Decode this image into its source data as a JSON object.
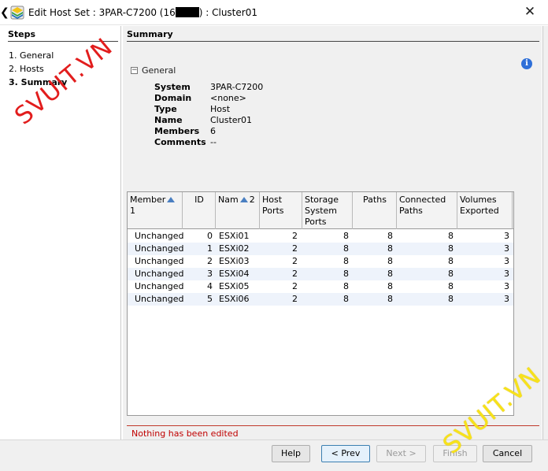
{
  "window": {
    "title_prefix": "Edit Host Set : 3PAR-C7200 (16",
    "title_suffix": ") : Cluster01",
    "close_glyph": "✕"
  },
  "steps": {
    "heading": "Steps",
    "items": [
      {
        "label": "1. General",
        "active": false
      },
      {
        "label": "2. Hosts",
        "active": false
      },
      {
        "label": "3. Summary",
        "active": true
      }
    ]
  },
  "summary": {
    "heading": "Summary",
    "section_label": "General",
    "collapse_glyph": "−",
    "info_glyph": "i",
    "properties": [
      {
        "key": "System",
        "value": "3PAR-C7200"
      },
      {
        "key": "Domain",
        "value": "<none>"
      },
      {
        "key": "Type",
        "value": "Host"
      },
      {
        "key": "Name",
        "value": "Cluster01"
      },
      {
        "key": "Members",
        "value": "6"
      },
      {
        "key": "Comments",
        "value": "--"
      }
    ]
  },
  "table": {
    "columns": [
      {
        "label": "Member",
        "sort_index": "1"
      },
      {
        "label": "ID"
      },
      {
        "label": "Nam",
        "sort_index": "2"
      },
      {
        "label": "Host Ports"
      },
      {
        "label": "Storage System Ports"
      },
      {
        "label": "Paths"
      },
      {
        "label": "Connected Paths"
      },
      {
        "label": "Volumes Exported"
      }
    ],
    "rows": [
      [
        "Unchanged",
        "0",
        "ESXi01",
        "2",
        "8",
        "8",
        "8",
        "3"
      ],
      [
        "Unchanged",
        "1",
        "ESXi02",
        "2",
        "8",
        "8",
        "8",
        "3"
      ],
      [
        "Unchanged",
        "2",
        "ESXi03",
        "2",
        "8",
        "8",
        "8",
        "3"
      ],
      [
        "Unchanged",
        "3",
        "ESXi04",
        "2",
        "8",
        "8",
        "8",
        "3"
      ],
      [
        "Unchanged",
        "4",
        "ESXi05",
        "2",
        "8",
        "8",
        "8",
        "3"
      ],
      [
        "Unchanged",
        "5",
        "ESXi06",
        "2",
        "8",
        "8",
        "8",
        "3"
      ]
    ]
  },
  "status": {
    "message": "Nothing has been edited",
    "color": "#c00000"
  },
  "footer": {
    "help": "Help",
    "prev": "< Prev",
    "next": "Next >",
    "finish": "Finish",
    "cancel": "Cancel"
  },
  "watermark": {
    "text_top": "SVUIT.VN",
    "text_bottom": "SVUIT.VN"
  },
  "colors": {
    "accent": "#3c7fb1",
    "row_alt": "#eef3fb",
    "watermark_red": "#e21d1d",
    "watermark_yellow": "#f7e21a"
  }
}
